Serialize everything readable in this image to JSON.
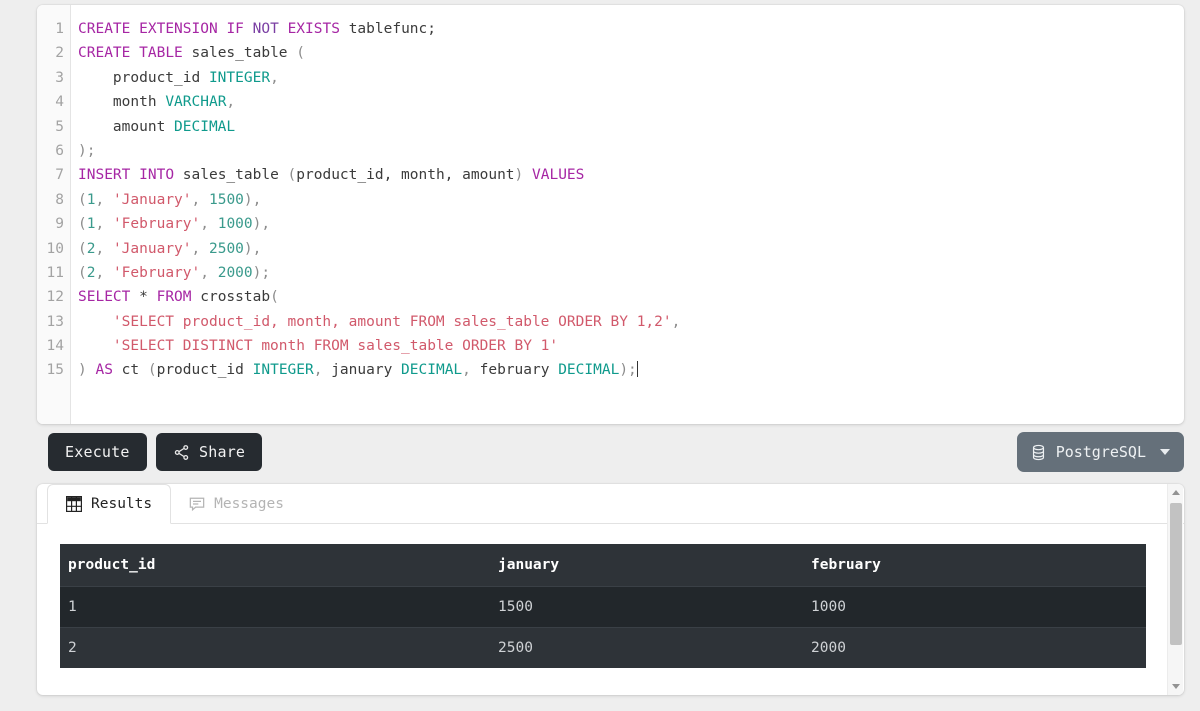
{
  "editor": {
    "lines": [
      {
        "num": "1",
        "tokens": [
          {
            "t": "k",
            "v": "CREATE"
          },
          {
            "t": "pl",
            "v": " "
          },
          {
            "t": "k",
            "v": "EXTENSION"
          },
          {
            "t": "pl",
            "v": " "
          },
          {
            "t": "k",
            "v": "IF"
          },
          {
            "t": "pl",
            "v": " "
          },
          {
            "t": "kb",
            "v": "NOT"
          },
          {
            "t": "pl",
            "v": " "
          },
          {
            "t": "k",
            "v": "EXISTS"
          },
          {
            "t": "pl",
            "v": " tablefunc;"
          }
        ]
      },
      {
        "num": "2",
        "tokens": [
          {
            "t": "k",
            "v": "CREATE"
          },
          {
            "t": "pl",
            "v": " "
          },
          {
            "t": "k",
            "v": "TABLE"
          },
          {
            "t": "pl",
            "v": " sales_table "
          },
          {
            "t": "p",
            "v": "("
          }
        ]
      },
      {
        "num": "3",
        "tokens": [
          {
            "t": "pl",
            "v": "    product_id "
          },
          {
            "t": "t",
            "v": "INTEGER"
          },
          {
            "t": "p",
            "v": ","
          }
        ]
      },
      {
        "num": "4",
        "tokens": [
          {
            "t": "pl",
            "v": "    month "
          },
          {
            "t": "t",
            "v": "VARCHAR"
          },
          {
            "t": "p",
            "v": ","
          }
        ]
      },
      {
        "num": "5",
        "tokens": [
          {
            "t": "pl",
            "v": "    amount "
          },
          {
            "t": "t",
            "v": "DECIMAL"
          }
        ]
      },
      {
        "num": "6",
        "tokens": [
          {
            "t": "p",
            "v": ")"
          },
          {
            "t": "p",
            "v": ";"
          }
        ]
      },
      {
        "num": "7",
        "tokens": [
          {
            "t": "k",
            "v": "INSERT"
          },
          {
            "t": "pl",
            "v": " "
          },
          {
            "t": "k",
            "v": "INTO"
          },
          {
            "t": "pl",
            "v": " sales_table "
          },
          {
            "t": "p",
            "v": "("
          },
          {
            "t": "pl",
            "v": "product_id, month, amount"
          },
          {
            "t": "p",
            "v": ")"
          },
          {
            "t": "pl",
            "v": " "
          },
          {
            "t": "k",
            "v": "VALUES"
          }
        ]
      },
      {
        "num": "8",
        "tokens": [
          {
            "t": "p",
            "v": "("
          },
          {
            "t": "n",
            "v": "1"
          },
          {
            "t": "p",
            "v": ", "
          },
          {
            "t": "s",
            "v": "'January'"
          },
          {
            "t": "p",
            "v": ", "
          },
          {
            "t": "n",
            "v": "1500"
          },
          {
            "t": "p",
            "v": "),"
          }
        ]
      },
      {
        "num": "9",
        "tokens": [
          {
            "t": "p",
            "v": "("
          },
          {
            "t": "n",
            "v": "1"
          },
          {
            "t": "p",
            "v": ", "
          },
          {
            "t": "s",
            "v": "'February'"
          },
          {
            "t": "p",
            "v": ", "
          },
          {
            "t": "n",
            "v": "1000"
          },
          {
            "t": "p",
            "v": "),"
          }
        ]
      },
      {
        "num": "10",
        "tokens": [
          {
            "t": "p",
            "v": "("
          },
          {
            "t": "n",
            "v": "2"
          },
          {
            "t": "p",
            "v": ", "
          },
          {
            "t": "s",
            "v": "'January'"
          },
          {
            "t": "p",
            "v": ", "
          },
          {
            "t": "n",
            "v": "2500"
          },
          {
            "t": "p",
            "v": "),"
          }
        ]
      },
      {
        "num": "11",
        "tokens": [
          {
            "t": "p",
            "v": "("
          },
          {
            "t": "n",
            "v": "2"
          },
          {
            "t": "p",
            "v": ", "
          },
          {
            "t": "s",
            "v": "'February'"
          },
          {
            "t": "p",
            "v": ", "
          },
          {
            "t": "n",
            "v": "2000"
          },
          {
            "t": "p",
            "v": ");"
          }
        ]
      },
      {
        "num": "12",
        "tokens": [
          {
            "t": "k",
            "v": "SELECT"
          },
          {
            "t": "pl",
            "v": " * "
          },
          {
            "t": "k",
            "v": "FROM"
          },
          {
            "t": "pl",
            "v": " crosstab"
          },
          {
            "t": "p",
            "v": "("
          }
        ]
      },
      {
        "num": "13",
        "tokens": [
          {
            "t": "pl",
            "v": "    "
          },
          {
            "t": "s",
            "v": "'SELECT product_id, month, amount FROM sales_table ORDER BY 1,2'"
          },
          {
            "t": "p",
            "v": ","
          }
        ]
      },
      {
        "num": "14",
        "tokens": [
          {
            "t": "pl",
            "v": "    "
          },
          {
            "t": "s",
            "v": "'SELECT DISTINCT month FROM sales_table ORDER BY 1'"
          }
        ]
      },
      {
        "num": "15",
        "tokens": [
          {
            "t": "p",
            "v": ")"
          },
          {
            "t": "pl",
            "v": " "
          },
          {
            "t": "k",
            "v": "AS"
          },
          {
            "t": "pl",
            "v": " ct "
          },
          {
            "t": "p",
            "v": "("
          },
          {
            "t": "pl",
            "v": "product_id "
          },
          {
            "t": "t",
            "v": "INTEGER"
          },
          {
            "t": "p",
            "v": ", "
          },
          {
            "t": "pl",
            "v": "january "
          },
          {
            "t": "t",
            "v": "DECIMAL"
          },
          {
            "t": "p",
            "v": ", "
          },
          {
            "t": "pl",
            "v": "february "
          },
          {
            "t": "t",
            "v": "DECIMAL"
          },
          {
            "t": "p",
            "v": ");"
          }
        ],
        "caret": true
      }
    ]
  },
  "toolbar": {
    "execute_label": "Execute",
    "share_label": "Share",
    "share_icon": "share-nodes-icon",
    "database_label": "PostgreSQL",
    "database_icon": "database-icon",
    "chevron_icon": "chevron-down-icon"
  },
  "results_panel": {
    "tabs": [
      {
        "label": "Results",
        "icon": "table-grid-icon",
        "active": true
      },
      {
        "label": "Messages",
        "icon": "message-bubble-icon",
        "active": false
      }
    ],
    "table": {
      "columns": [
        "product_id",
        "january",
        "february"
      ],
      "rows": [
        [
          "1",
          "1500",
          "1000"
        ],
        [
          "2",
          "2500",
          "2000"
        ]
      ]
    },
    "scrollbar": {
      "up_icon": "scroll-up-arrow-icon",
      "down_icon": "scroll-down-arrow-icon"
    }
  },
  "colors": {
    "page_bg": "#eeeeee",
    "button_bg": "#262b30",
    "db_select_bg": "#65707a",
    "table_header_bg": "#2e3338",
    "table_row_alt_bg": "#22272b",
    "keyword": "#a626a4",
    "type": "#0f9a8c",
    "string": "#d1596b"
  }
}
